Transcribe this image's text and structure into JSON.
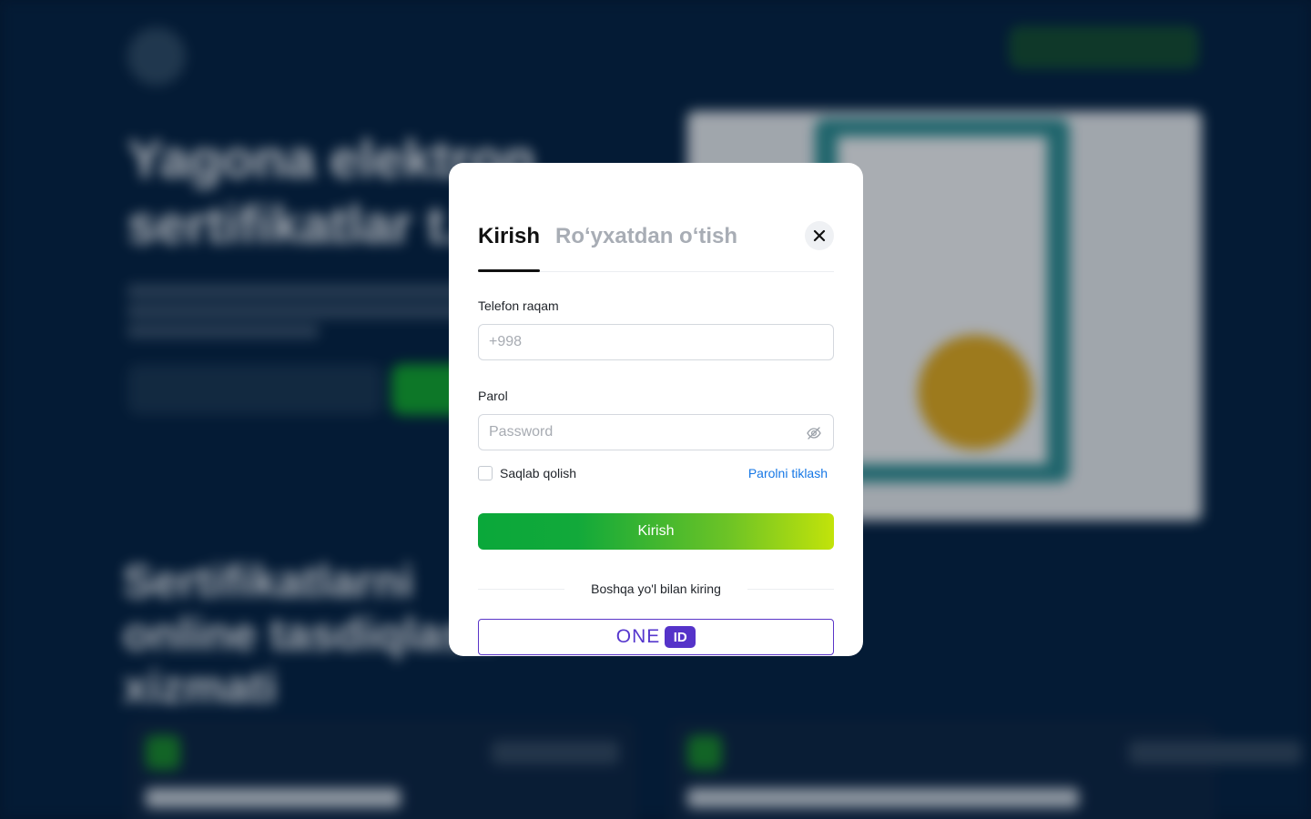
{
  "background": {
    "hero_title": "Yagona elektron sertifikatlar t...",
    "section_title": "Sertifikatlarni online tasdiqlash xizmati"
  },
  "modal": {
    "tabs": [
      {
        "label": "Kirish",
        "active": true
      },
      {
        "label": "Roʻyxatdan oʻtish",
        "active": false
      }
    ],
    "phone": {
      "label": "Telefon raqam",
      "placeholder": "+998",
      "value": ""
    },
    "password": {
      "label": "Parol",
      "placeholder": "Password",
      "value": ""
    },
    "remember_label": "Saqlab qolish",
    "remember_checked": false,
    "forgot_link": "Parolni tiklash",
    "submit_label": "Kirish",
    "alt_login_text": "Boshqa yo'l bilan kiring",
    "oneid": {
      "text": "ONE",
      "badge": "ID"
    }
  },
  "colors": {
    "primary_green": "#0aa83a",
    "gradient_end": "#c2e30a",
    "link_blue": "#1677e5",
    "oneid_purple": "#5533c9",
    "backdrop": "#061a33"
  }
}
